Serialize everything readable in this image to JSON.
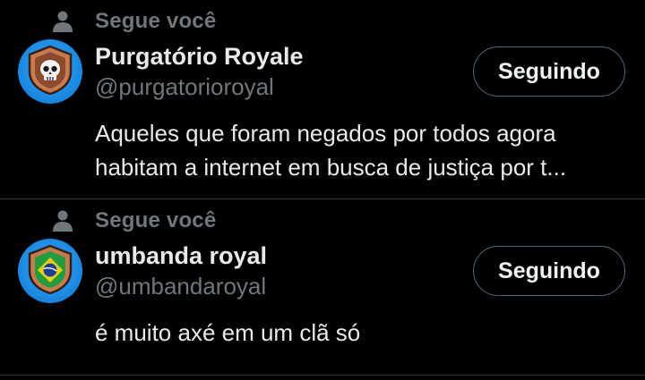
{
  "colors": {
    "background": "#000000",
    "primary_text": "#e7e9ea",
    "secondary_text": "#71767b",
    "divider": "#2f3336",
    "button_border": "#536471",
    "avatar_blue": "#1d9bf0"
  },
  "accounts": [
    {
      "follows_you": "Segue você",
      "name": "Purgatório Royale",
      "handle": "@purgatorioroyal",
      "button_label": "Seguindo",
      "bio_lines": [
        "Aqueles que foram negados por todos agora",
        "habitam a internet em busca de justiça por t..."
      ],
      "avatar_icon": "skull-shield-icon"
    },
    {
      "follows_you": "Segue você",
      "name": "umbanda royal",
      "handle": "@umbandaroyal",
      "button_label": "Seguindo",
      "bio_lines": [
        "é muito axé em um clã só"
      ],
      "avatar_icon": "brazil-flag-shield-icon"
    }
  ]
}
